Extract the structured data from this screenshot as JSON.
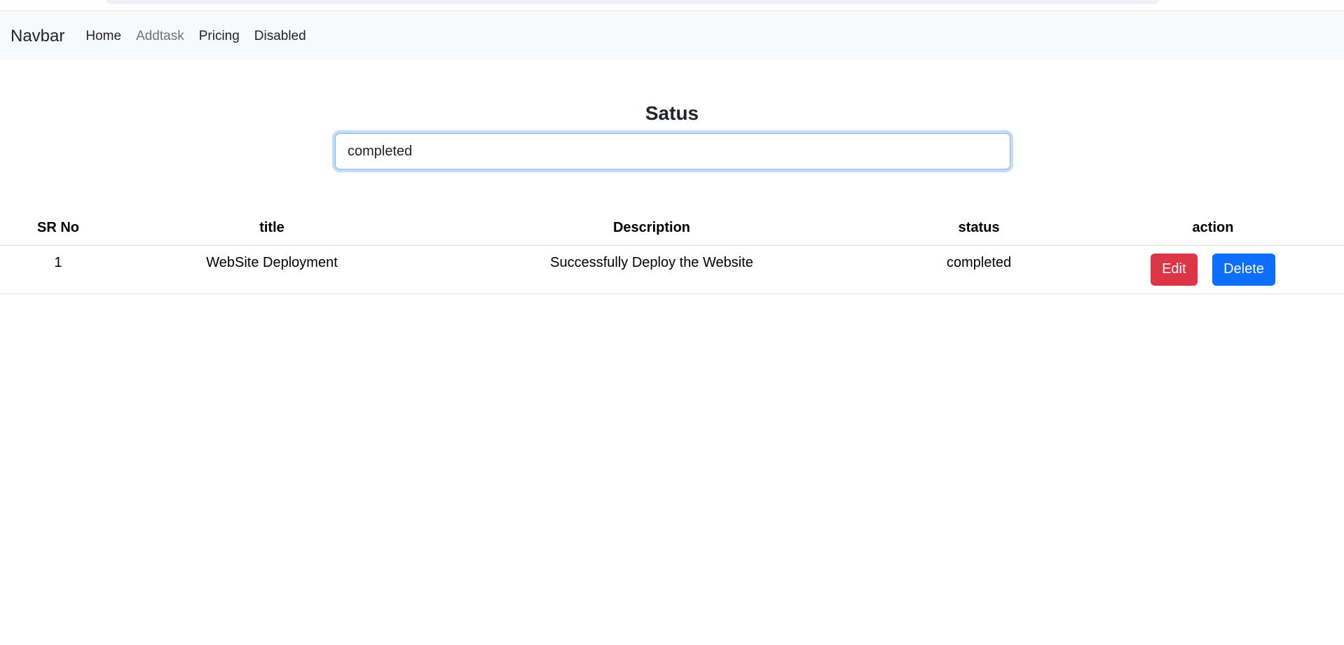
{
  "navbar": {
    "brand": "Navbar",
    "links": [
      {
        "label": "Home"
      },
      {
        "label": "Addtask",
        "active": true
      },
      {
        "label": "Pricing"
      },
      {
        "label": "Disabled"
      }
    ]
  },
  "filter": {
    "heading": "Satus",
    "value": "completed"
  },
  "table": {
    "headers": [
      "SR No",
      "title",
      "Description",
      "status",
      "action"
    ],
    "rows": [
      {
        "sr": "1",
        "title": "WebSite Deployment",
        "description": "Successfully Deploy the Website",
        "status": "completed",
        "edit_label": "Edit",
        "delete_label": "Delete"
      }
    ]
  },
  "colors": {
    "navbar_bg": "#f8f9fa",
    "edit_button": "#dc3545",
    "delete_button": "#0d6efd",
    "input_focus": "#86b7fe"
  }
}
